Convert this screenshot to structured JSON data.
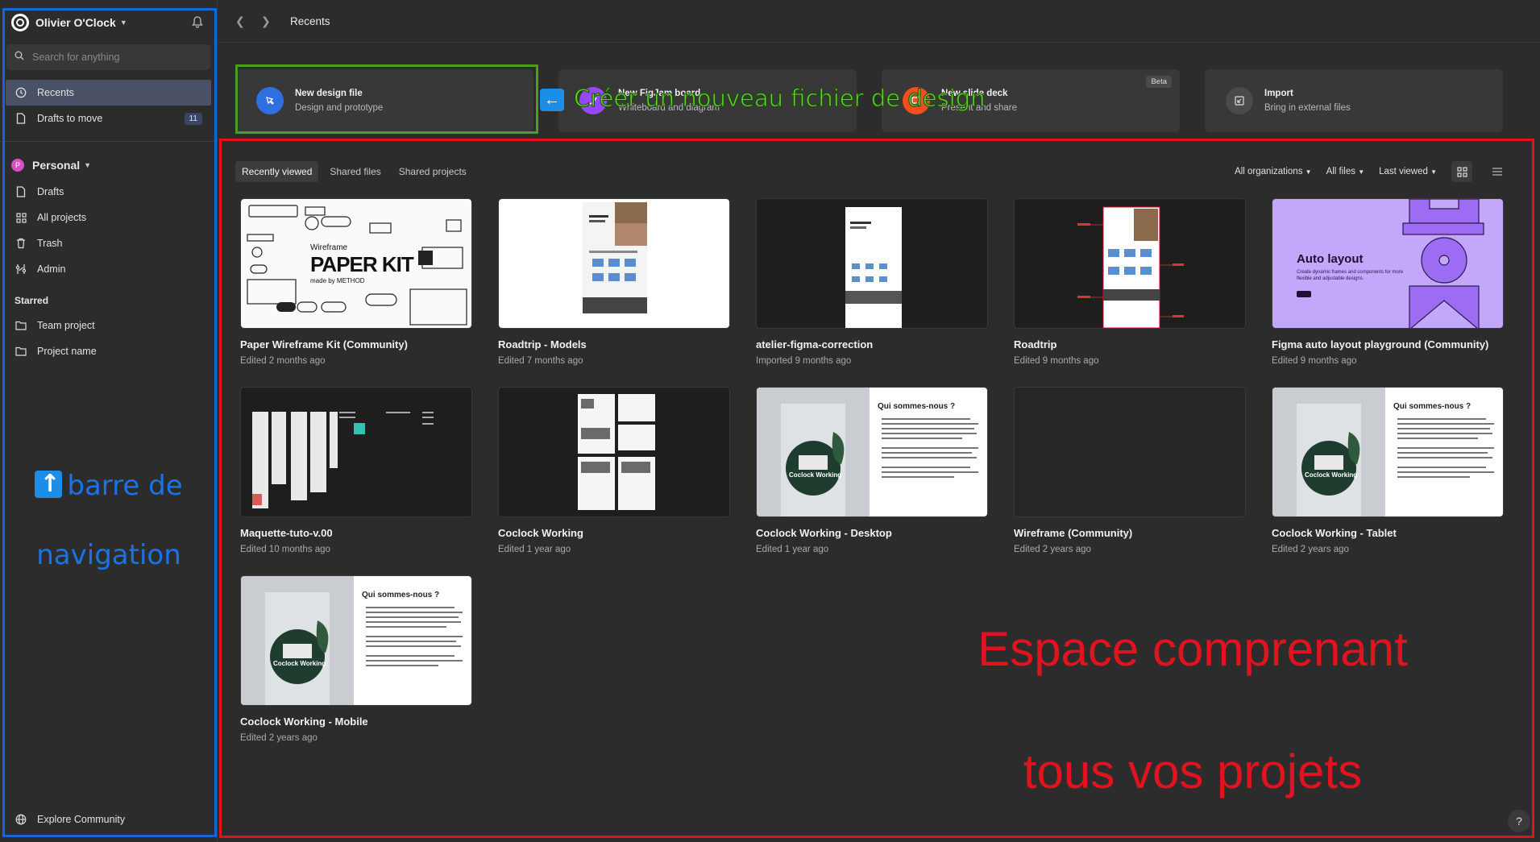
{
  "sidebar": {
    "user_name": "Olivier O'Clock",
    "search_placeholder": "Search for anything",
    "nav": [
      {
        "label": "Recents",
        "icon": "clock-icon"
      },
      {
        "label": "Drafts to move",
        "icon": "file-icon",
        "badge": "11"
      }
    ],
    "team": {
      "initial": "P",
      "name": "Personal"
    },
    "team_nav": [
      {
        "label": "Drafts",
        "icon": "file-icon"
      },
      {
        "label": "All projects",
        "icon": "grid-icon"
      },
      {
        "label": "Trash",
        "icon": "trash-icon"
      },
      {
        "label": "Admin",
        "icon": "admin-icon"
      }
    ],
    "starred_label": "Starred",
    "starred": [
      {
        "label": "Team project",
        "icon": "folder-icon"
      },
      {
        "label": "Project name",
        "icon": "folder-icon"
      }
    ],
    "explore_label": "Explore Community"
  },
  "topbar": {
    "title": "Recents"
  },
  "create": [
    {
      "title": "New design file",
      "subtitle": "Design and prototype",
      "color": "#2f6fe0"
    },
    {
      "title": "New FigJam board",
      "subtitle": "Whiteboard and diagram",
      "color": "#9747ff"
    },
    {
      "title": "New slide deck",
      "subtitle": "Present and share",
      "color": "#f24e1e",
      "badge": "Beta"
    },
    {
      "title": "Import",
      "subtitle": "Bring in external files",
      "color": "#4a4a4a"
    }
  ],
  "tabs": [
    "Recently viewed",
    "Shared files",
    "Shared projects"
  ],
  "filters": [
    "All organizations",
    "All files",
    "Last viewed"
  ],
  "files": [
    {
      "name": "Paper Wireframe Kit (Community)",
      "meta": "Edited 2 months ago",
      "thumb": "paper",
      "thumb_title": "PAPER KIT",
      "thumb_pre": "Wireframe",
      "thumb_by": "made by METHOD"
    },
    {
      "name": "Roadtrip - Models",
      "meta": "Edited 7 months ago",
      "thumb": "web-white"
    },
    {
      "name": "atelier-figma-correction",
      "meta": "Imported 9 months ago",
      "thumb": "web-dark"
    },
    {
      "name": "Roadtrip",
      "meta": "Edited 9 months ago",
      "thumb": "web-dark-annot"
    },
    {
      "name": "Figma auto layout playground (Community)",
      "meta": "Edited 9 months ago",
      "thumb": "autolayout",
      "thumb_title": "Auto layout",
      "thumb_sub": "Create dynamic frames and components for more flexible and adjustable designs."
    },
    {
      "name": "Maquette-tuto-v.00",
      "meta": "Edited 10 months ago",
      "thumb": "maquette"
    },
    {
      "name": "Coclock Working",
      "meta": "Edited 1 year ago",
      "thumb": "pages"
    },
    {
      "name": "Coclock Working - Desktop",
      "meta": "Edited 1 year ago",
      "thumb": "coclock",
      "thumb_title": "Qui sommes-nous ?",
      "thumb_logo": "Coclock Working"
    },
    {
      "name": "Wireframe (Community)",
      "meta": "Edited 2 years ago",
      "thumb": "empty"
    },
    {
      "name": "Coclock Working - Tablet",
      "meta": "Edited 2 years ago",
      "thumb": "coclock",
      "thumb_title": "Qui sommes-nous ?",
      "thumb_logo": "Coclock Working"
    },
    {
      "name": "Coclock Working - Mobile",
      "meta": "Edited 2 years ago",
      "thumb": "coclock",
      "thumb_title": "Qui sommes-nous ?",
      "thumb_logo": "Coclock Working"
    }
  ],
  "annotations": {
    "green_text": "Créer un nouveau fichier de design",
    "blue_text": "barre de navigation",
    "red_text": "Espace comprenant tous vos projets"
  },
  "help_label": "?"
}
